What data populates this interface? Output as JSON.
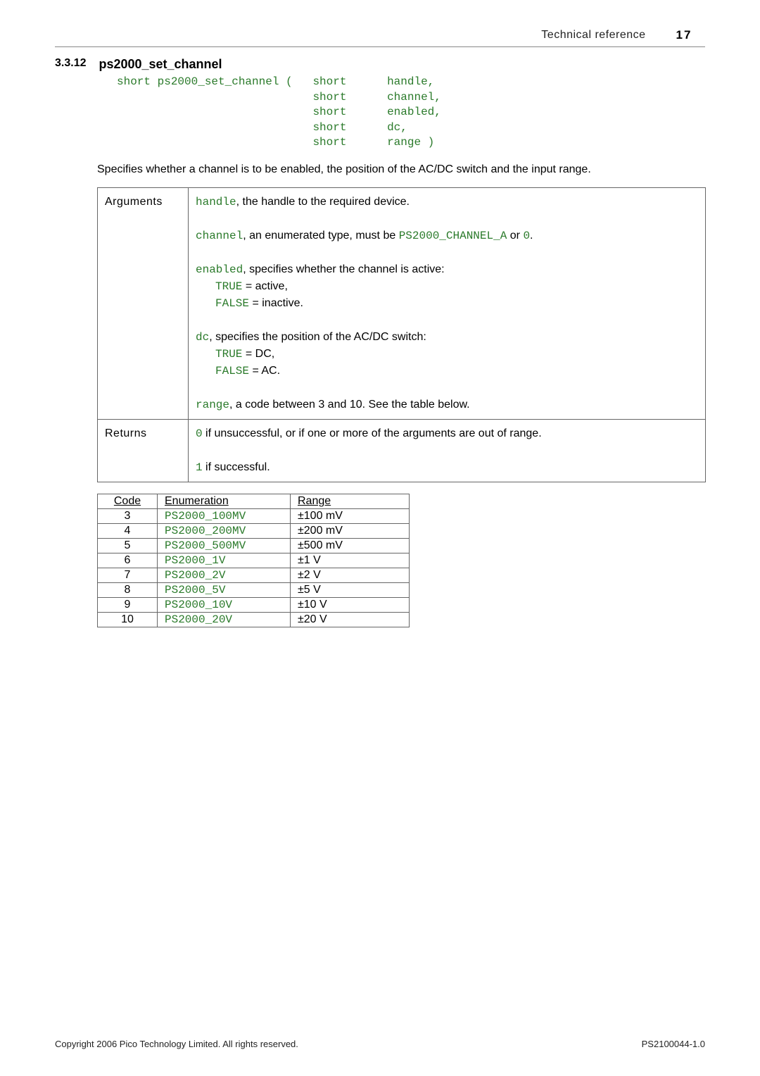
{
  "header": {
    "title": "Technical reference",
    "page_number": "17"
  },
  "section": {
    "number": "3.3.12",
    "title": "ps2000_set_channel"
  },
  "code_signature": "short ps2000_set_channel (   short      handle,\n                             short      channel,\n                             short      enabled,\n                             short      dc,\n                             short      range )",
  "intro_text": "Specifies whether a channel is to be enabled, the position of the AC/DC switch and the input range.",
  "args": {
    "label": "Arguments",
    "handle_pre": "handle",
    "handle_post": ", the handle to the required device.",
    "channel_pre": "channel",
    "channel_mid": ", an enumerated type, must be ",
    "channel_code": "PS2000_CHANNEL_A",
    "channel_or": " or ",
    "channel_zero": "0",
    "enabled_pre": "enabled",
    "enabled_post": ", specifies whether the channel is active:",
    "enabled_true_code": "TRUE",
    "enabled_true_txt": " = active,",
    "enabled_false_code": "FALSE",
    "enabled_false_txt": " = inactive.",
    "dc_pre": "dc",
    "dc_post": ", specifies the position of the AC/DC switch:",
    "dc_true_code": "TRUE",
    "dc_true_txt": " = DC,",
    "dc_false_code": "FALSE",
    "dc_false_txt": " = AC.",
    "range_pre": "range",
    "range_post": ", a code between 3 and 10.  See the table below."
  },
  "returns": {
    "label": "Returns",
    "zero": "0",
    "zero_post": " if unsuccessful, or if one or more of the arguments are out of range.",
    "one": "1",
    "one_post": " if successful."
  },
  "range_table": {
    "headers": {
      "code": "Code",
      "enum": "Enumeration",
      "range": "Range"
    },
    "rows": [
      {
        "code": "3",
        "enum": "PS2000_100MV",
        "range": "±100 mV"
      },
      {
        "code": "4",
        "enum": "PS2000_200MV",
        "range": "±200 mV"
      },
      {
        "code": "5",
        "enum": "PS2000_500MV",
        "range": "±500 mV"
      },
      {
        "code": "6",
        "enum": "PS2000_1V",
        "range": "±1 V"
      },
      {
        "code": "7",
        "enum": "PS2000_2V",
        "range": "±2 V"
      },
      {
        "code": "8",
        "enum": "PS2000_5V",
        "range": "±5 V"
      },
      {
        "code": "9",
        "enum": "PS2000_10V",
        "range": "±10 V"
      },
      {
        "code": "10",
        "enum": "PS2000_20V",
        "range": "±20 V"
      }
    ]
  },
  "footer": {
    "left": "Copyright 2006 Pico Technology Limited. All rights reserved.",
    "right": "PS2100044-1.0"
  }
}
